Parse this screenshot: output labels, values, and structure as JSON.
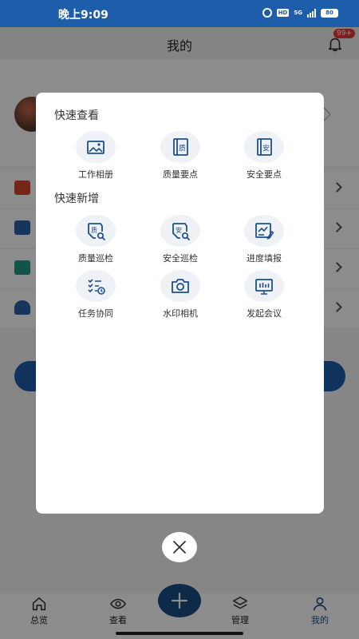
{
  "status_bar": {
    "time": "晚上9:09",
    "network": "5G",
    "hd": "HD",
    "battery": "80"
  },
  "header": {
    "title": "我的",
    "notification_badge": "99+"
  },
  "modal": {
    "quick_view": {
      "title": "快速查看",
      "items": [
        {
          "label": "工作相册",
          "icon": "photo-album-icon"
        },
        {
          "label": "质量要点",
          "icon": "quality-book-icon"
        },
        {
          "label": "安全要点",
          "icon": "safety-book-icon"
        }
      ]
    },
    "quick_add": {
      "title": "快速新增",
      "items": [
        {
          "label": "质量巡检",
          "icon": "quality-inspection-icon"
        },
        {
          "label": "安全巡检",
          "icon": "safety-inspection-icon"
        },
        {
          "label": "进度填报",
          "icon": "progress-report-icon"
        },
        {
          "label": "任务协同",
          "icon": "task-collab-icon"
        },
        {
          "label": "水印相机",
          "icon": "camera-icon"
        },
        {
          "label": "发起会议",
          "icon": "meeting-icon"
        }
      ]
    }
  },
  "bottom_nav": {
    "items": [
      {
        "label": "总览",
        "icon": "home-icon"
      },
      {
        "label": "查看",
        "icon": "eye-icon"
      },
      {
        "label": "管理",
        "icon": "layers-icon"
      },
      {
        "label": "我的",
        "icon": "user-icon"
      }
    ],
    "active": "我的"
  },
  "colors": {
    "brand_blue": "#1d5da9",
    "fab_blue": "#1a4d86",
    "icon_blue": "#1d4f8c",
    "badge_red": "#e53935"
  }
}
